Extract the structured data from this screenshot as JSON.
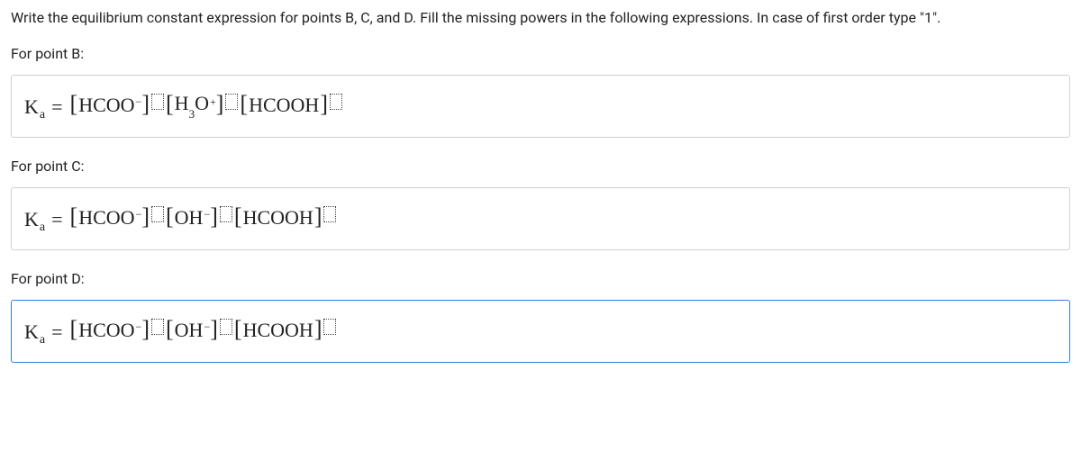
{
  "instruction": "Write the equilibrium constant expression for points B, C, and D. Fill the missing powers in the following expressions. In case of first order type \"1\".",
  "pointB": {
    "label": "For point B:",
    "K": "K",
    "sub": "a",
    "eq": "=",
    "term1": "HCOO",
    "term1_charge": "−",
    "term2_pre": "H",
    "term2_subn": "3",
    "term2_post": "O",
    "term2_charge": "+",
    "term3": "HCOOH"
  },
  "pointC": {
    "label": "For point C:",
    "K": "K",
    "sub": "a",
    "eq": "=",
    "term1": "HCOO",
    "term1_charge": "−",
    "term2": "OH",
    "term2_charge": "−",
    "term3": "HCOOH"
  },
  "pointD": {
    "label": "For point D:",
    "K": "K",
    "sub": "a",
    "eq": "=",
    "term1": "HCOO",
    "term1_charge": "−",
    "term2": "OH",
    "term2_charge": "−",
    "term3": "HCOOH"
  }
}
